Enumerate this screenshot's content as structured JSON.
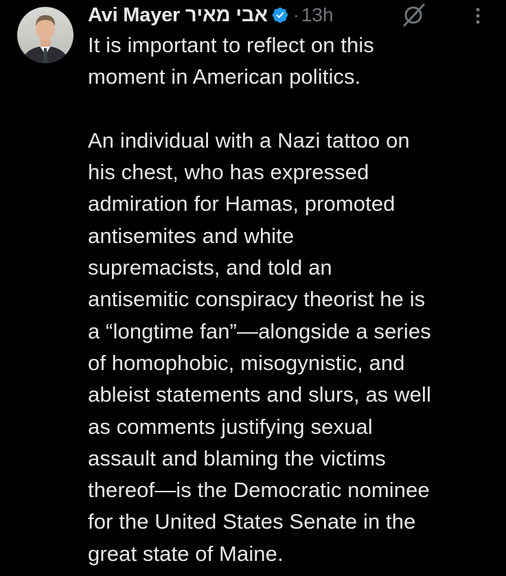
{
  "author": {
    "display_name": "Avi Mayer אבי מאיר",
    "verified_icon": "verified-badge-icon",
    "separator": "·",
    "timestamp": "13h"
  },
  "actions": {
    "grok_icon": "grok-icon",
    "more_icon": "more-vertical-icon"
  },
  "tweet": {
    "lines_p1": [
      "It is important to reflect on this",
      "moment in American politics."
    ],
    "lines_p2": [
      "An individual with a Nazi tattoo on",
      "his chest, who has expressed",
      "admiration for Hamas, promoted",
      "antisemites and white",
      "supremacists, and told an",
      "antisemitic conspiracy theorist he is",
      "a “longtime fan”—alongside a series",
      "of homophobic, misogynistic, and",
      "ableist statements and slurs, as well",
      "as comments justifying sexual",
      "assault and blaming the victims",
      "thereof—is the Democratic nominee",
      "for the United States Senate in the",
      "great state of Maine."
    ]
  },
  "colors": {
    "background": "#000000",
    "text": "#e7e9ea",
    "secondary": "#71767b",
    "verified": "#1d9bf0"
  }
}
